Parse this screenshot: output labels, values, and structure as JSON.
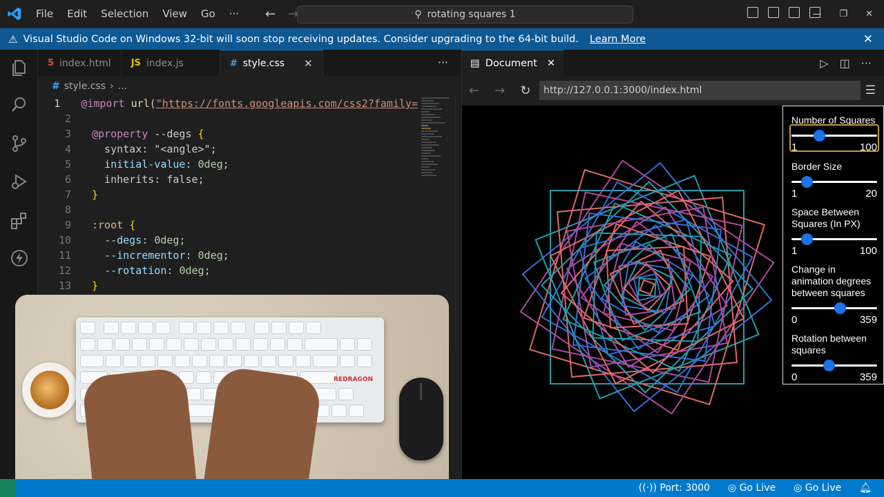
{
  "titlebar": {
    "menu": [
      "File",
      "Edit",
      "Selection",
      "View",
      "Go",
      "···"
    ],
    "command_center": "rotating squares 1"
  },
  "banner": {
    "message": "Visual Studio Code on Windows 32-bit will soon stop receiving updates. Consider upgrading to the 64-bit build.",
    "link": "Learn More"
  },
  "editor": {
    "tabs": [
      {
        "badge": "5",
        "label": "index.html"
      },
      {
        "badge": "JS",
        "label": "index.js"
      },
      {
        "badge": "#",
        "label": "style.css"
      }
    ],
    "breadcrumb": {
      "file": "style.css",
      "rest": "..."
    },
    "lines": [
      {
        "n": "1",
        "text": "@import url(\"https://fonts.googleapis.com/css2?family="
      },
      {
        "n": "2",
        "text": ""
      },
      {
        "n": "3",
        "text": "@property --degs {"
      },
      {
        "n": "4",
        "text": "  syntax: \"<angle>\";"
      },
      {
        "n": "5",
        "text": "  initial-value: 0deg;"
      },
      {
        "n": "6",
        "text": "  inherits: false;"
      },
      {
        "n": "7",
        "text": "}"
      },
      {
        "n": "8",
        "text": ""
      },
      {
        "n": "9",
        "text": ":root {"
      },
      {
        "n": "10",
        "text": "  --degs: 0deg;"
      },
      {
        "n": "11",
        "text": "  --incrementor: 0deg;"
      },
      {
        "n": "12",
        "text": "  --rotation: 0deg;"
      },
      {
        "n": "13",
        "text": "}"
      }
    ],
    "overlay_brand": "REDRAGON"
  },
  "preview": {
    "tab_label": "Document",
    "url": "http://127.0.0.1:3000/index.html",
    "controls": {
      "squares": {
        "label": "Number of Squares",
        "min": "1",
        "max": "100",
        "value_fraction": 0.32
      },
      "border": {
        "label": "Border Size",
        "min": "1",
        "max": "20",
        "value_fraction": 0.16
      },
      "space": {
        "label": "Space Between Squares (In PX)",
        "min": "1",
        "max": "100",
        "value_fraction": 0.18
      },
      "change": {
        "label": "Change in animation degrees between squares",
        "min": "0",
        "max": "359",
        "value_fraction": 0.55
      },
      "rotation": {
        "label": "Rotation between squares",
        "min": "0",
        "max": "359",
        "value_fraction": 0.45
      }
    },
    "colors": [
      "#1f9fb0",
      "#e06b68",
      "#b04ba0",
      "#3a6fd0"
    ]
  },
  "statusbar": {
    "port": "Port: 3000",
    "golive1": "Go Live",
    "golive2": "Go Live"
  }
}
